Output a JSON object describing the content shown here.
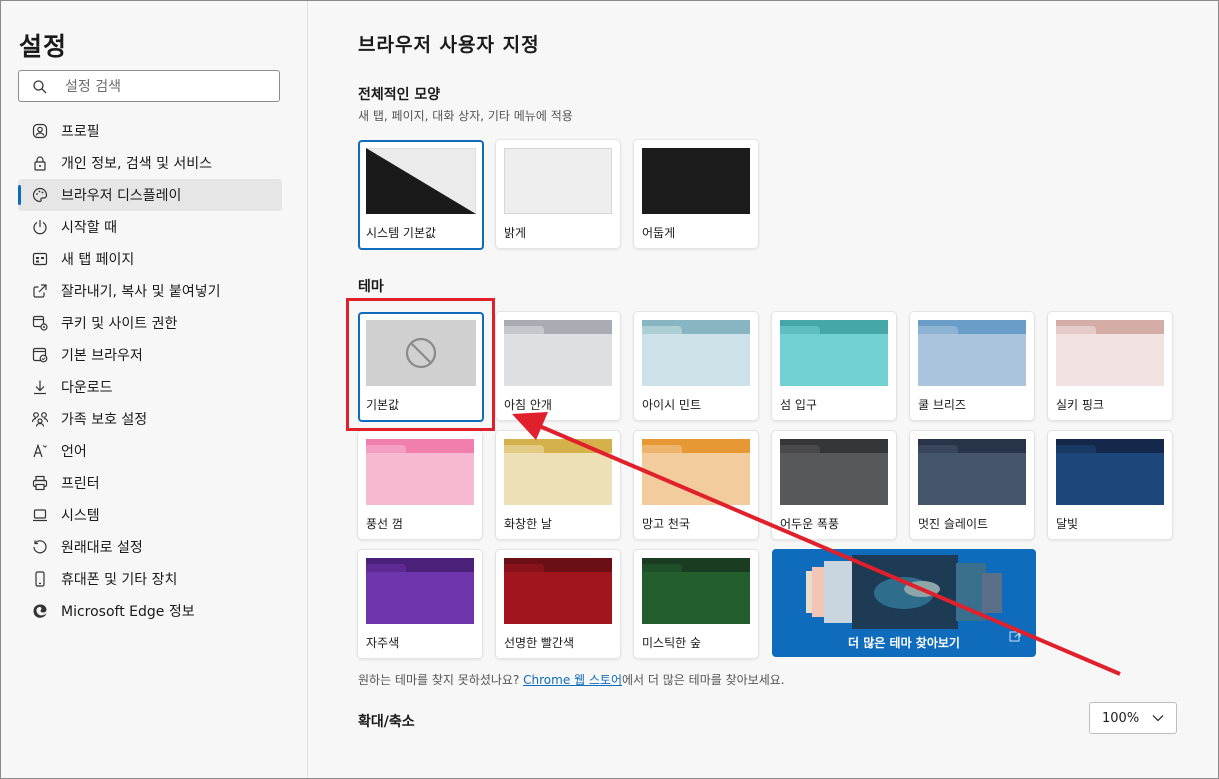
{
  "sidebar": {
    "title": "설정",
    "search_placeholder": "설정 검색",
    "items": [
      {
        "label": "프로필",
        "icon": "profile-icon"
      },
      {
        "label": "개인 정보, 검색 및 서비스",
        "icon": "lock-icon"
      },
      {
        "label": "브라우저 디스플레이",
        "icon": "palette-icon",
        "active": true
      },
      {
        "label": "시작할 때",
        "icon": "power-icon"
      },
      {
        "label": "새 탭 페이지",
        "icon": "new-tab-icon"
      },
      {
        "label": "잘라내기, 복사 및 붙여넣기",
        "icon": "share-icon"
      },
      {
        "label": "쿠키 및 사이트 권한",
        "icon": "cookie-icon"
      },
      {
        "label": "기본 브라우저",
        "icon": "browser-icon"
      },
      {
        "label": "다운로드",
        "icon": "download-icon"
      },
      {
        "label": "가족 보호 설정",
        "icon": "family-icon"
      },
      {
        "label": "언어",
        "icon": "language-icon"
      },
      {
        "label": "프린터",
        "icon": "printer-icon"
      },
      {
        "label": "시스템",
        "icon": "laptop-icon"
      },
      {
        "label": "원래대로 설정",
        "icon": "reset-icon"
      },
      {
        "label": "휴대폰 및 기타 장치",
        "icon": "phone-icon"
      },
      {
        "label": "Microsoft Edge 정보",
        "icon": "edge-logo-icon"
      }
    ]
  },
  "main": {
    "title": "브라우저 사용자 지정",
    "appearance": {
      "heading": "전체적인 모양",
      "description": "새 탭, 페이지, 대화 상자, 기타 메뉴에 적용",
      "options": [
        {
          "label": "시스템 기본값",
          "selected": true
        },
        {
          "label": "밝게"
        },
        {
          "label": "어둡게"
        }
      ]
    },
    "themes": {
      "heading": "테마",
      "items": [
        {
          "label": "기본값",
          "selected": true
        },
        {
          "label": "아침 안개",
          "tab": "#a9acb3",
          "body": "#dedfe2"
        },
        {
          "label": "아이시 민트",
          "tab": "#87b6c2",
          "body": "#cde2e8"
        },
        {
          "label": "섬 입구",
          "tab": "#46a8a6",
          "body": "#72d2d2"
        },
        {
          "label": "쿨 브리즈",
          "tab": "#6a9ec9",
          "body": "#a9c4dc"
        },
        {
          "label": "실키 핑크",
          "tab": "#d5ada7",
          "body": "#f2e3e2"
        },
        {
          "label": "풍선 껌",
          "tab": "#f07fad",
          "body": "#f7b8d1"
        },
        {
          "label": "화창한 날",
          "tab": "#d4b14a",
          "body": "#ede0b6"
        },
        {
          "label": "망고 천국",
          "tab": "#e69835",
          "body": "#f3cc9d"
        },
        {
          "label": "어두운 폭풍",
          "tab": "#35363a",
          "body": "#57585c"
        },
        {
          "label": "멋진 슬레이트",
          "tab": "#27344a",
          "body": "#45556b"
        },
        {
          "label": "달빛",
          "tab": "#13284a",
          "body": "#1d477a"
        },
        {
          "label": "자주색",
          "tab": "#4b2078",
          "body": "#6f35ad"
        },
        {
          "label": "선명한 빨간색",
          "tab": "#6b0f15",
          "body": "#a1151f"
        },
        {
          "label": "미스틱한 숲",
          "tab": "#1a3d22",
          "body": "#235e2e"
        }
      ],
      "more_label": "더 많은 테마 찾아보기"
    },
    "note_prefix": "원하는 테마를 찾지 못하셨나요? ",
    "note_link": "Chrome 웹 스토어",
    "note_suffix": "에서 더 많은 테마를 찾아보세요.",
    "zoom": {
      "label": "확대/축소",
      "value": "100%"
    }
  },
  "colors": {
    "accent": "#0f6cbd",
    "highlight": "#e0202a"
  }
}
